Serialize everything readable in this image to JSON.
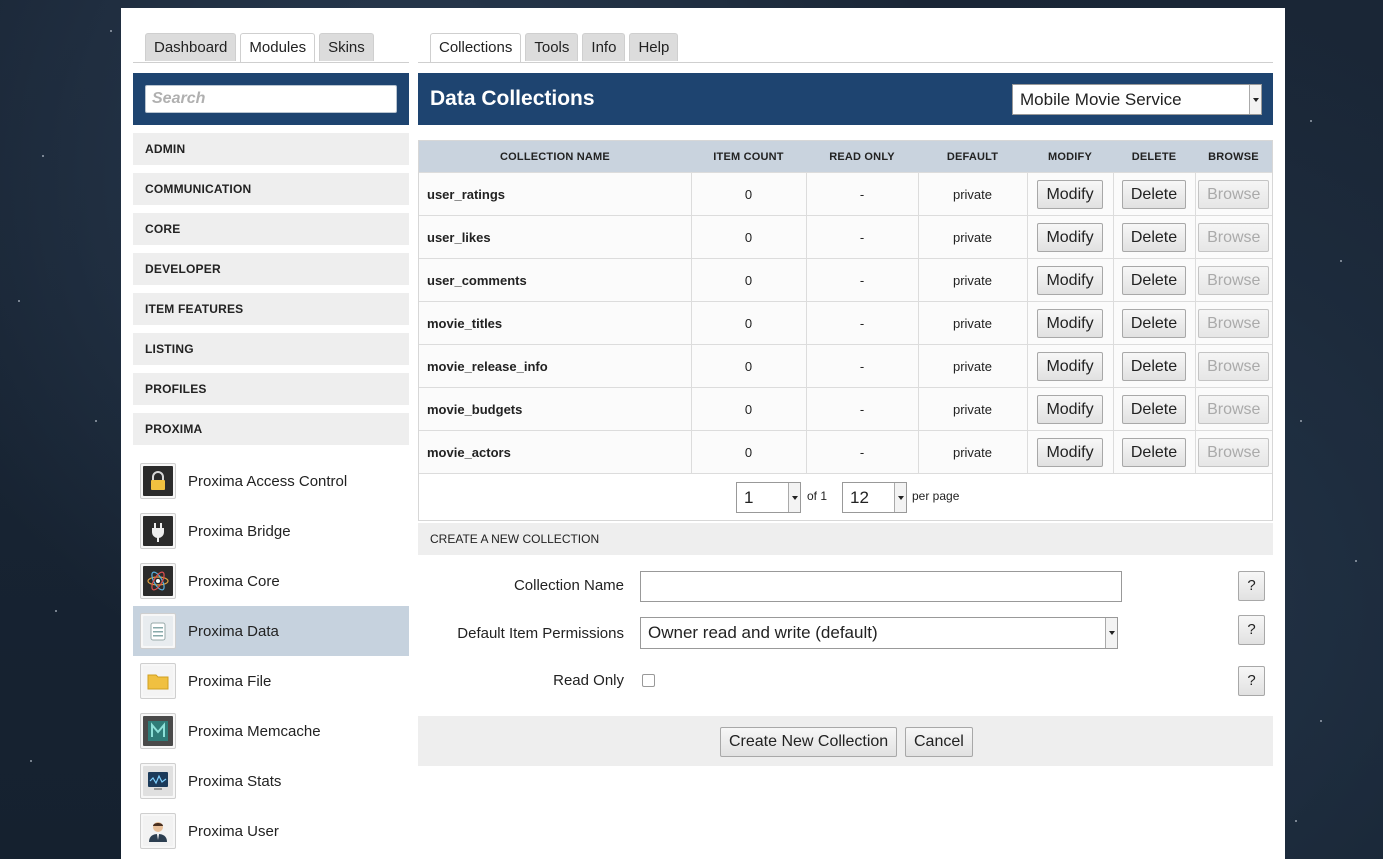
{
  "nav": {
    "left_tabs": [
      "Dashboard",
      "Modules",
      "Skins"
    ],
    "right_tabs": [
      "Collections",
      "Tools",
      "Info",
      "Help"
    ],
    "active_left": "Modules",
    "active_right": "Collections"
  },
  "sidebar": {
    "search_placeholder": "Search",
    "categories": [
      "ADMIN",
      "COMMUNICATION",
      "CORE",
      "DEVELOPER",
      "ITEM FEATURES",
      "LISTING",
      "PROFILES",
      "PROXIMA"
    ],
    "modules": [
      {
        "label": "Proxima Access Control",
        "icon": "padlock-icon",
        "selected": false
      },
      {
        "label": "Proxima Bridge",
        "icon": "plug-icon",
        "selected": false
      },
      {
        "label": "Proxima Core",
        "icon": "atom-icon",
        "selected": false
      },
      {
        "label": "Proxima Data",
        "icon": "database-icon",
        "selected": true
      },
      {
        "label": "Proxima File",
        "icon": "folder-icon",
        "selected": false
      },
      {
        "label": "Proxima Memcache",
        "icon": "memcache-m-icon",
        "selected": false
      },
      {
        "label": "Proxima Stats",
        "icon": "monitor-stats-icon",
        "selected": false
      },
      {
        "label": "Proxima User",
        "icon": "user-person-icon",
        "selected": false
      }
    ]
  },
  "main": {
    "title": "Data Collections",
    "service_selected": "Mobile Movie Service",
    "table": {
      "headers": [
        "COLLECTION NAME",
        "ITEM COUNT",
        "READ ONLY",
        "DEFAULT",
        "MODIFY",
        "DELETE",
        "BROWSE"
      ],
      "rows": [
        {
          "name": "user_ratings",
          "count": "0",
          "read_only": "-",
          "default": "private"
        },
        {
          "name": "user_likes",
          "count": "0",
          "read_only": "-",
          "default": "private"
        },
        {
          "name": "user_comments",
          "count": "0",
          "read_only": "-",
          "default": "private"
        },
        {
          "name": "movie_titles",
          "count": "0",
          "read_only": "-",
          "default": "private"
        },
        {
          "name": "movie_release_info",
          "count": "0",
          "read_only": "-",
          "default": "private"
        },
        {
          "name": "movie_budgets",
          "count": "0",
          "read_only": "-",
          "default": "private"
        },
        {
          "name": "movie_actors",
          "count": "0",
          "read_only": "-",
          "default": "private"
        }
      ],
      "modify_label": "Modify",
      "delete_label": "Delete",
      "browse_label": "Browse"
    },
    "pager": {
      "page": "1",
      "of_text": "of 1",
      "per_page": "12",
      "per_page_text": "per page"
    }
  },
  "create": {
    "heading": "CREATE A NEW COLLECTION",
    "name_label": "Collection Name",
    "name_value": "",
    "perm_label": "Default Item Permissions",
    "perm_value": "Owner read and write (default)",
    "readonly_label": "Read Only",
    "help_label": "?",
    "create_button": "Create New Collection",
    "cancel_button": "Cancel"
  }
}
